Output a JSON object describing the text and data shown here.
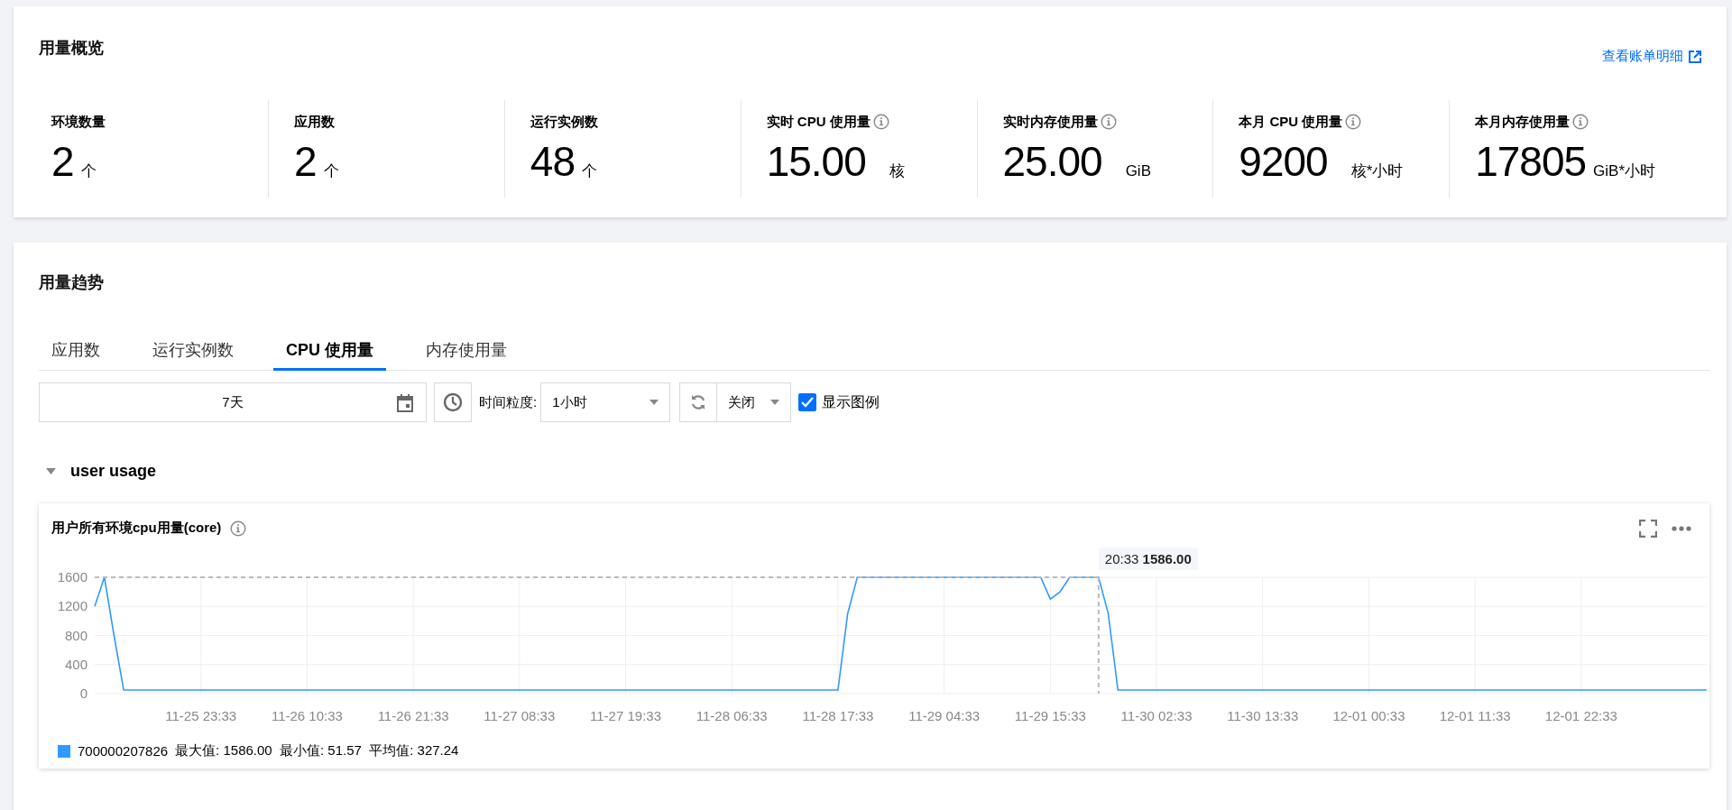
{
  "overview": {
    "title": "用量概览",
    "link": "查看账单明细",
    "stats": [
      {
        "label": "环境数量",
        "info": false,
        "value": "2",
        "unit": "个"
      },
      {
        "label": "应用数",
        "info": false,
        "value": "2",
        "unit": "个"
      },
      {
        "label": "运行实例数",
        "info": false,
        "value": "48",
        "unit": "个"
      },
      {
        "label": "实时 CPU 使用量",
        "info": true,
        "value": "15.00",
        "unit": "核"
      },
      {
        "label": "实时内存使用量",
        "info": true,
        "value": "25.00",
        "unit": "GiB"
      },
      {
        "label": "本月 CPU 使用量",
        "info": true,
        "value": "9200",
        "unit": "核*小时"
      },
      {
        "label": "本月内存使用量",
        "info": true,
        "value": "17805",
        "unit": "GiB*小时"
      }
    ]
  },
  "trend": {
    "title": "用量趋势",
    "tabs": [
      {
        "label": "应用数",
        "selected": false
      },
      {
        "label": "运行实例数",
        "selected": false
      },
      {
        "label": "CPU 使用量",
        "selected": true
      },
      {
        "label": "内存使用量",
        "selected": false
      }
    ],
    "date_range": {
      "value": "7天"
    },
    "granularity": {
      "label": "时间粒度:",
      "value": "1小时"
    },
    "refresh": {
      "value": "关闭"
    },
    "show_legend": {
      "label": "显示图例",
      "checked": true
    },
    "group": {
      "title": "user usage",
      "expanded": true
    },
    "chart": {
      "title": "用户所有环境cpu用量(core)",
      "legend": [
        {
          "stats": "最大值: 1586.00  最小值: 51.57  平均值: 327.24"
        }
      ],
      "chart_data": {
        "type": "line",
        "categories": [
          null,
          null,
          null,
          null,
          null,
          null,
          null,
          null,
          null,
          null,
          null,
          "11-25 23:33",
          null,
          null,
          null,
          null,
          null,
          null,
          null,
          null,
          null,
          null,
          "11-26 10:33",
          null,
          null,
          null,
          null,
          null,
          null,
          null,
          null,
          null,
          null,
          "11-26 21:33",
          null,
          null,
          null,
          null,
          null,
          null,
          null,
          null,
          null,
          null,
          "11-27 08:33",
          null,
          null,
          null,
          null,
          null,
          null,
          null,
          null,
          null,
          null,
          "11-27 19:33",
          null,
          null,
          null,
          null,
          null,
          null,
          null,
          null,
          null,
          null,
          "11-28 06:33",
          null,
          null,
          null,
          null,
          null,
          null,
          null,
          null,
          null,
          null,
          "11-28 17:33",
          null,
          null,
          null,
          null,
          null,
          null,
          null,
          null,
          null,
          null,
          "11-29 04:33",
          null,
          null,
          null,
          null,
          null,
          null,
          null,
          null,
          null,
          null,
          "11-29 15:33",
          null,
          null,
          null,
          null,
          null,
          null,
          null,
          null,
          null,
          null,
          "11-30 02:33",
          null,
          null,
          null,
          null,
          null,
          null,
          null,
          null,
          null,
          null,
          "11-30 13:33",
          null,
          null,
          null,
          null,
          null,
          null,
          null,
          null,
          null,
          null,
          "12-01 00:33",
          null,
          null,
          null,
          null,
          null,
          null,
          null,
          null,
          null,
          null,
          "12-01 11:33",
          null,
          null,
          null,
          null,
          null,
          null,
          null,
          null,
          null,
          null,
          "12-01 22:33",
          null,
          null,
          null,
          null,
          null,
          null,
          null,
          null,
          null,
          null,
          null,
          null,
          null
        ],
        "series": [
          {
            "name": "700000207826",
            "color": "#2e9bff",
            "values": [
              1200,
              1600,
              800,
              50,
              50,
              50,
              50,
              50,
              50,
              50,
              50,
              50,
              50,
              50,
              50,
              50,
              50,
              50,
              50,
              50,
              50,
              50,
              50,
              50,
              50,
              50,
              50,
              50,
              50,
              50,
              50,
              50,
              50,
              50,
              50,
              50,
              50,
              50,
              50,
              50,
              50,
              50,
              50,
              50,
              50,
              50,
              50,
              50,
              50,
              50,
              50,
              50,
              50,
              50,
              50,
              50,
              50,
              50,
              50,
              50,
              50,
              50,
              50,
              50,
              50,
              50,
              50,
              50,
              50,
              50,
              50,
              50,
              50,
              50,
              50,
              50,
              50,
              50,
              1100,
              1600,
              1600,
              1600,
              1600,
              1600,
              1600,
              1600,
              1600,
              1600,
              1600,
              1600,
              1600,
              1600,
              1600,
              1600,
              1600,
              1600,
              1600,
              1600,
              1600,
              1300,
              1400,
              1600,
              1600,
              1600,
              1600,
              1100,
              50,
              50,
              50,
              50,
              50,
              50,
              50,
              50,
              50,
              50,
              50,
              50,
              50,
              50,
              50,
              50,
              50,
              50,
              50,
              50,
              50,
              50,
              50,
              50,
              50,
              50,
              50,
              50,
              50,
              50,
              50,
              50,
              50,
              50,
              50,
              50,
              50,
              50,
              50,
              50,
              50,
              50,
              50,
              50,
              50,
              50,
              50,
              50,
              50,
              50,
              50,
              50,
              50,
              50,
              50,
              50,
              50,
              50,
              50,
              50,
              50,
              50
            ]
          }
        ],
        "ylim": [
          0,
          1600
        ],
        "yticks": [
          0,
          400,
          800,
          1200,
          1600
        ],
        "grid": true
      },
      "tooltip": {
        "time": "20:33",
        "value": "1586.00"
      }
    }
  }
}
